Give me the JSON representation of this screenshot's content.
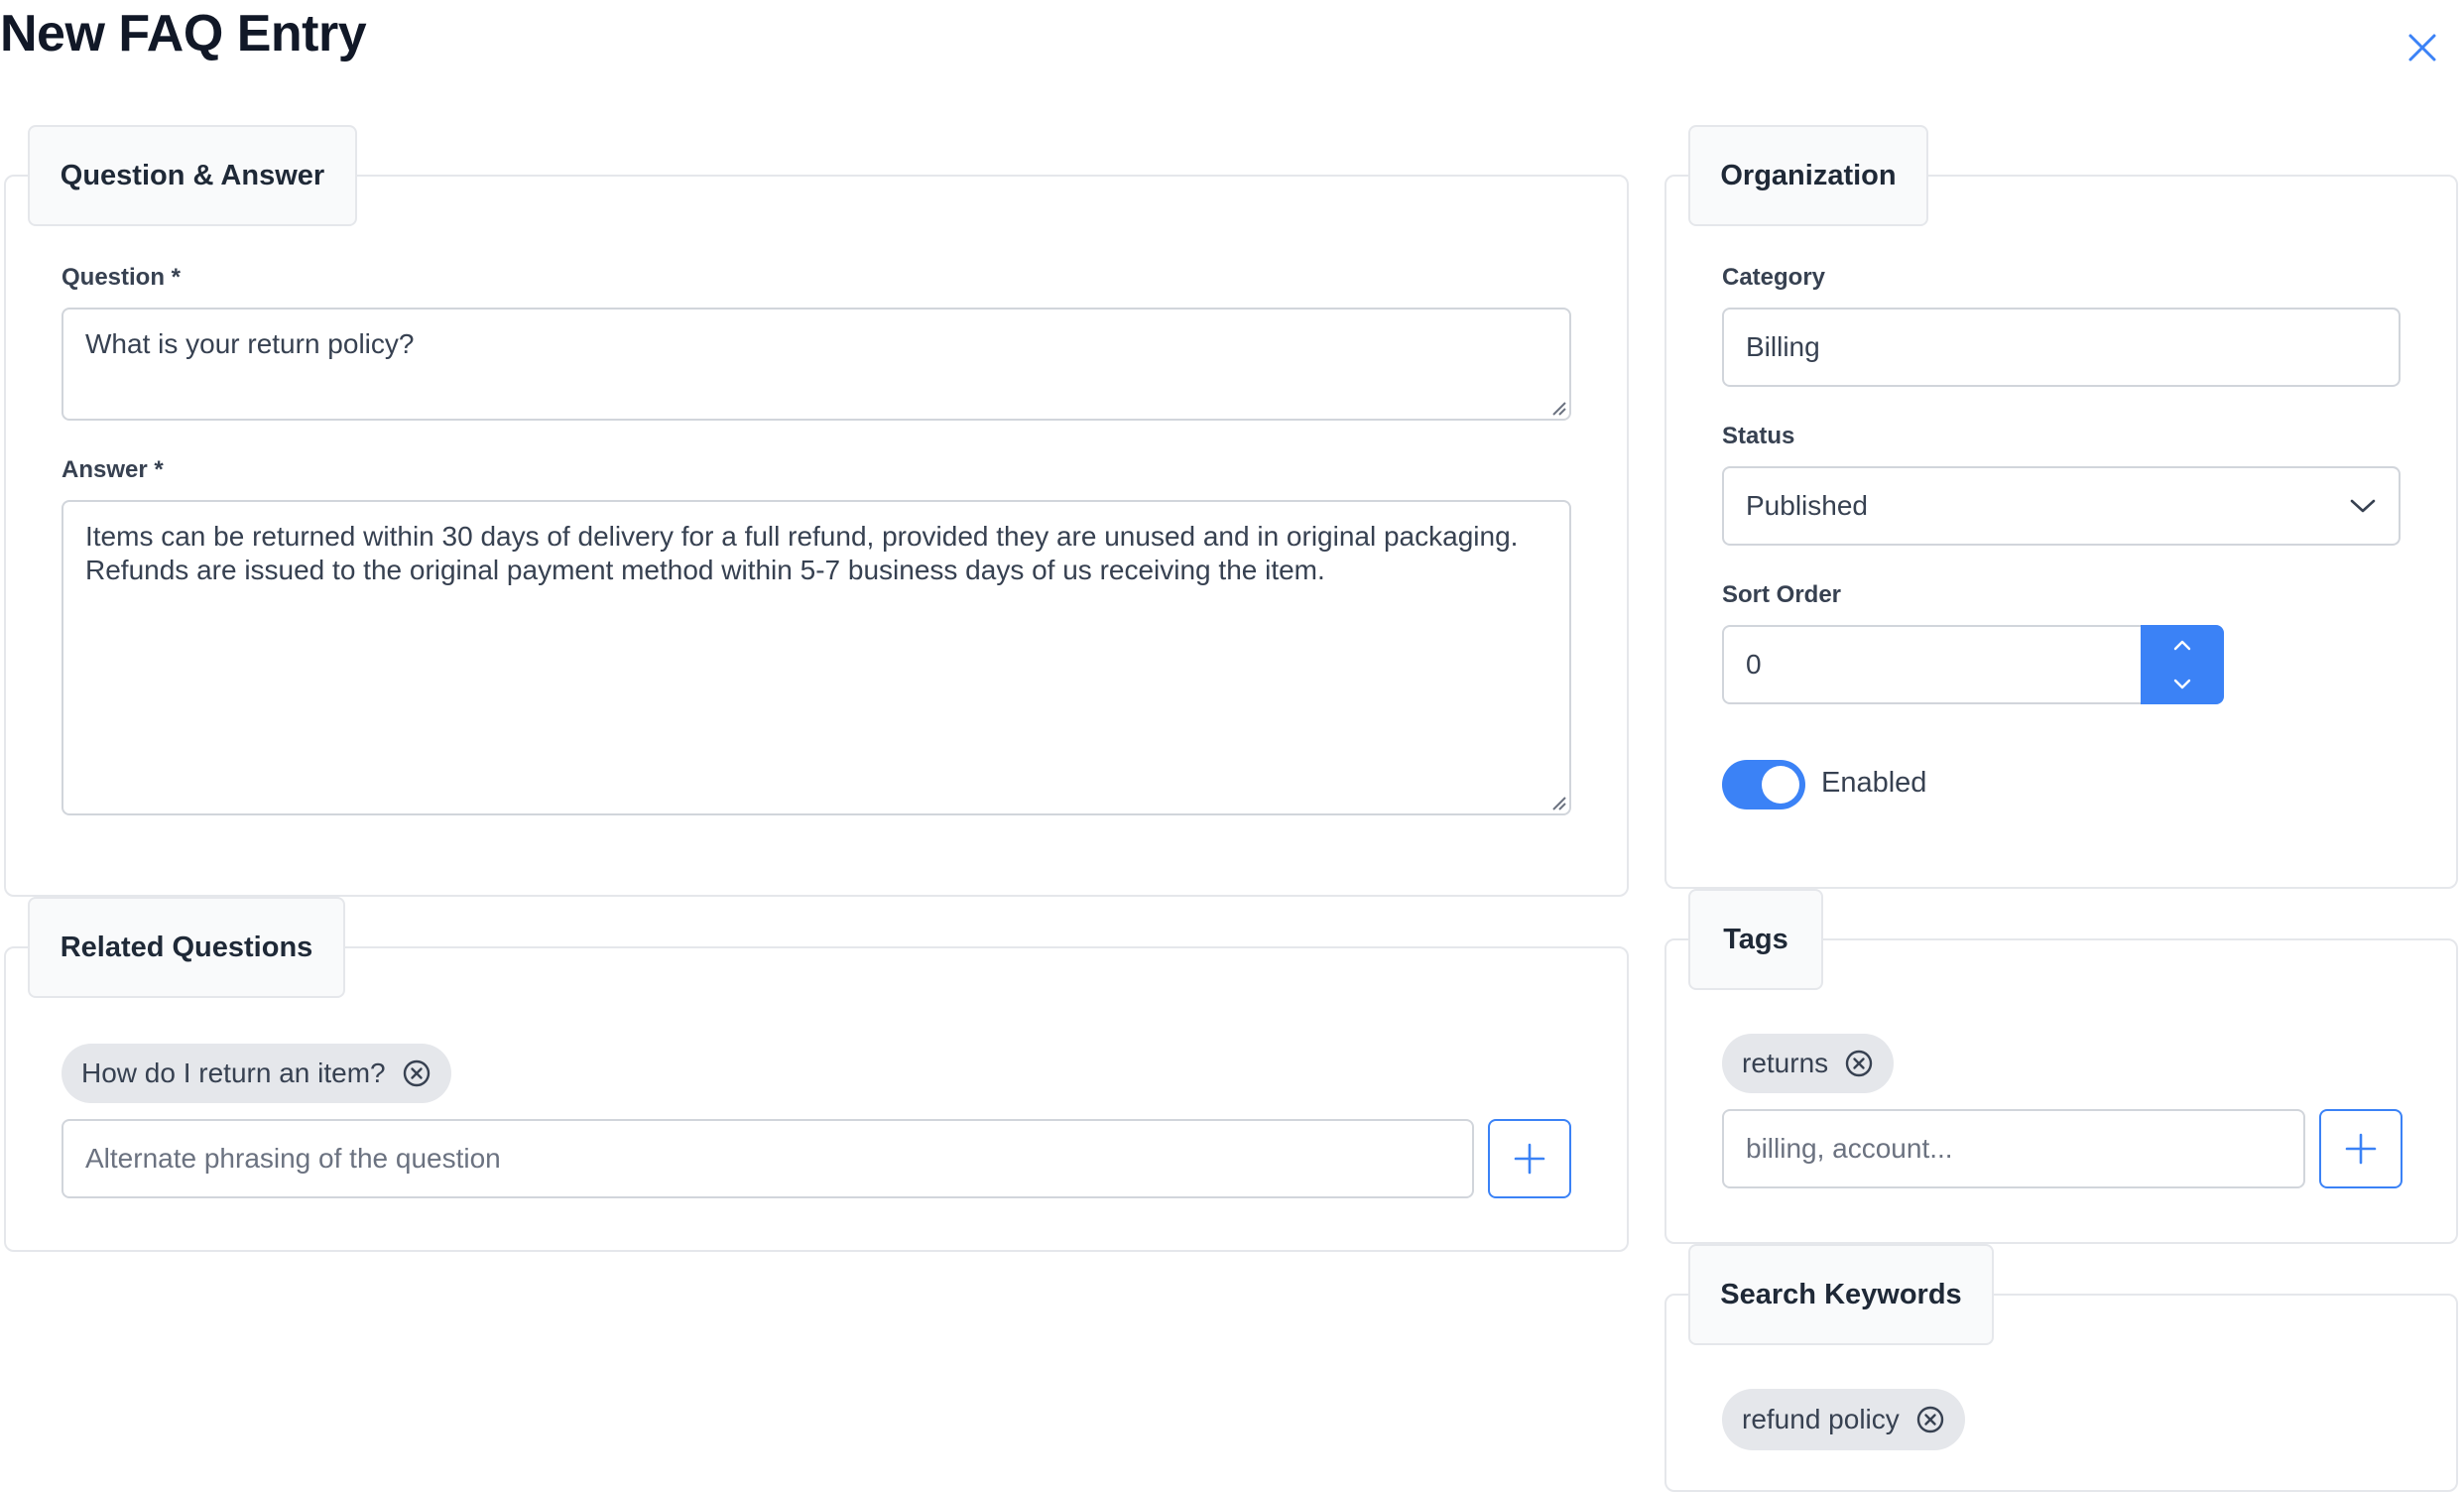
{
  "dialog": {
    "title": "New FAQ Entry",
    "close_icon": "close-icon"
  },
  "qa_section": {
    "legend": "Question & Answer",
    "question_label": "Question *",
    "question_value": "What is your return policy?",
    "answer_label": "Answer *",
    "answer_value": "Items can be returned within 30 days of delivery for a full refund, provided they are unused and in original packaging. Refunds are issued to the original payment method within 5-7 business days of us receiving the item."
  },
  "related_section": {
    "legend": "Related Questions",
    "chips": [
      "How do I return an item?"
    ],
    "input_placeholder": "Alternate phrasing of the question"
  },
  "organization": {
    "legend": "Organization",
    "category_label": "Category",
    "category_value": "Billing",
    "status_label": "Status",
    "status_value": "Published",
    "sort_label": "Sort Order",
    "sort_value": "0",
    "toggle_label": "Enabled",
    "toggle_on": true
  },
  "tags_section": {
    "legend": "Tags",
    "chips": [
      "returns"
    ],
    "input_placeholder": "billing, account..."
  },
  "keywords_section": {
    "legend": "Search Keywords",
    "chips": [
      "refund policy"
    ]
  },
  "colors": {
    "accent": "#3b82f6",
    "border": "#e5e7eb",
    "chip_bg": "#e5e7eb"
  }
}
